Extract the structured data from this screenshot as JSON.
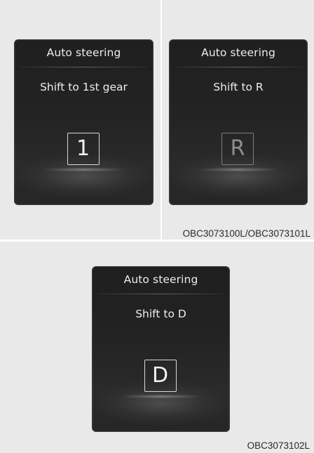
{
  "screens": [
    {
      "title": "Auto steering",
      "message": "Shift to 1st gear",
      "gear": "1",
      "gear_state": "active"
    },
    {
      "title": "Auto steering",
      "message": "Shift to R",
      "gear": "R",
      "gear_state": "dim"
    },
    {
      "title": "Auto steering",
      "message": "Shift to D",
      "gear": "D",
      "gear_state": "active"
    }
  ],
  "codes": {
    "top": "OBC3073100L/OBC3073101L",
    "bottom": "OBC3073102L"
  },
  "colors": {
    "panel_background": "#e9e9e9",
    "screen_background": "#232323",
    "screen_text": "#ececec",
    "dim_gear": "#8f8f8f"
  }
}
